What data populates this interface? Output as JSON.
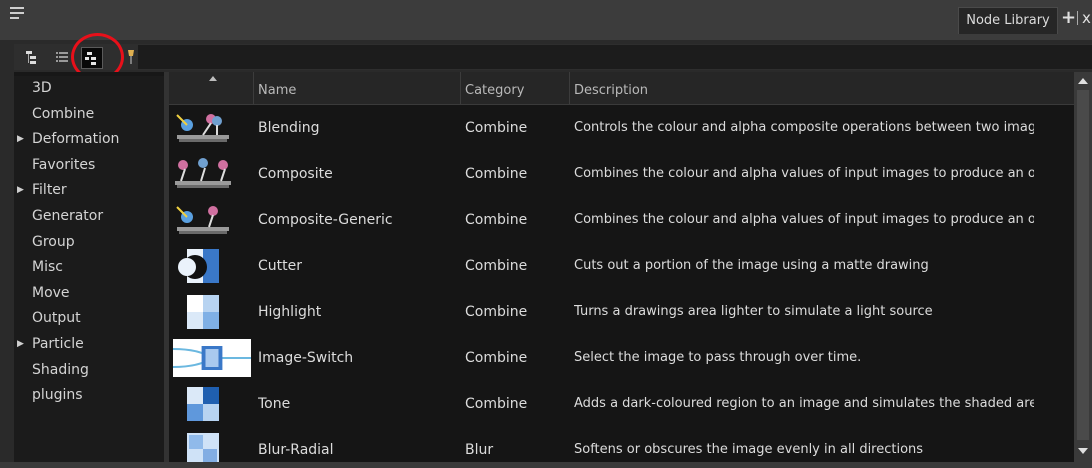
{
  "window": {
    "tab_title": "Node Library",
    "add_symbol": "+",
    "close_symbol": "x"
  },
  "toolbar": {
    "tools": [
      "tree-view-icon",
      "list-view-icon",
      "icon-view-icon",
      "pin-icon"
    ]
  },
  "annotation": {
    "color": "#e8101a",
    "target": "icon-view-button"
  },
  "sidebar": {
    "items": [
      {
        "label": "3D",
        "expandable": false
      },
      {
        "label": "Combine",
        "expandable": false
      },
      {
        "label": "Deformation",
        "expandable": true
      },
      {
        "label": "Favorites",
        "expandable": false
      },
      {
        "label": "Filter",
        "expandable": true
      },
      {
        "label": "Generator",
        "expandable": false
      },
      {
        "label": "Group",
        "expandable": false
      },
      {
        "label": "Misc",
        "expandable": false
      },
      {
        "label": "Move",
        "expandable": false
      },
      {
        "label": "Output",
        "expandable": false
      },
      {
        "label": "Particle",
        "expandable": true
      },
      {
        "label": "Shading",
        "expandable": false
      },
      {
        "label": "plugins",
        "expandable": false
      }
    ]
  },
  "table": {
    "columns": {
      "name": "Name",
      "category": "Category",
      "description": "Description"
    },
    "rows": [
      {
        "icon": "blending-icon",
        "name": "Blending",
        "category": "Combine",
        "description": "Controls the colour and alpha composite operations between two imag..."
      },
      {
        "icon": "composite-icon",
        "name": "Composite",
        "category": "Combine",
        "description": "Combines the colour and alpha values of input images to produce an o..."
      },
      {
        "icon": "composite-generic-icon",
        "name": "Composite-Generic",
        "category": "Combine",
        "description": "Combines the colour and alpha values of input images to produce an o..."
      },
      {
        "icon": "cutter-icon",
        "name": "Cutter",
        "category": "Combine",
        "description": "Cuts out a portion of the image using a matte drawing"
      },
      {
        "icon": "highlight-icon",
        "name": "Highlight",
        "category": "Combine",
        "description": "Turns a drawings area lighter to simulate a light source"
      },
      {
        "icon": "image-switch-icon",
        "name": "Image-Switch",
        "category": "Combine",
        "description": "Select the image to pass through over time."
      },
      {
        "icon": "tone-icon",
        "name": "Tone",
        "category": "Combine",
        "description": "Adds a dark-coloured region to an image and simulates the shaded area..."
      },
      {
        "icon": "blur-radial-icon",
        "name": "Blur-Radial",
        "category": "Blur",
        "description": "Softens or obscures the image evenly in all directions"
      }
    ]
  }
}
